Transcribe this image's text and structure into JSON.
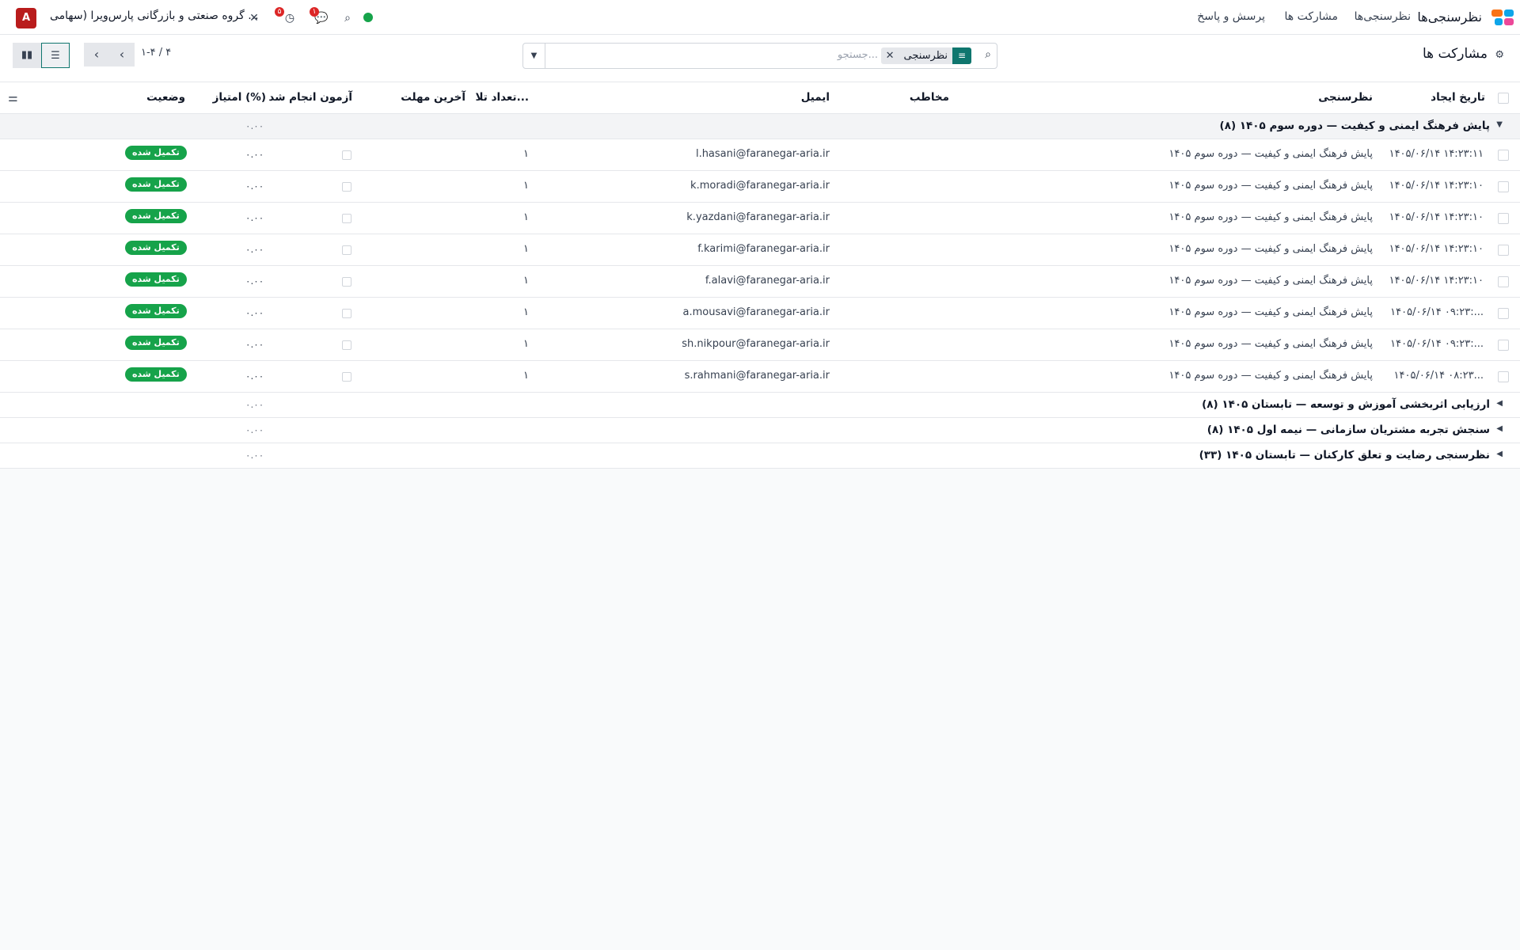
{
  "navbar": {
    "app_name": "نظرسنجی‌ها",
    "menu": [
      "نظرسنجی‌ها",
      "مشارکت ها",
      "پرسش و پاسخ"
    ],
    "company": "گروه صنعتی و بازرگانی پارس‌ویرا (سهامی ...",
    "avatar_letter": "A",
    "activity_badge": "۵",
    "messages_badge": "۱",
    "colors": {
      "brand_teal": "#0f766e",
      "status_green": "#16a34a",
      "avatar_red": "#b91c1c"
    }
  },
  "control": {
    "title": "مشارکت ها",
    "search_placeholder": "جستجو...",
    "facet_label": "نظرسنجی",
    "pager": "۱-۴ / ۴"
  },
  "columns": {
    "created": "تاریخ ایجاد",
    "survey": "نظرسنجی",
    "contact": "مخاطب",
    "email": "ایمیل",
    "attempts": "تعداد تلا...",
    "deadline": "آخرین مهلت",
    "done": "آزمون انجام شد",
    "score": "امتیاز (%)",
    "status": "وضعیت"
  },
  "open_group": {
    "label": "پایش فرهنگ ایمنی و کیفیت — دوره سوم ۱۴۰۵ (۸)",
    "score_sum": "۰.۰۰"
  },
  "rows": [
    {
      "created": "۱۴۰۵/۰۶/۱۴ ۱۴:۲۳:۱۱",
      "survey": "پایش فرهنگ ایمنی و کیفیت — دوره سوم ۱۴۰۵",
      "email": "l.hasani@faranegar-aria.ir",
      "attempts": "۱",
      "score": "۰.۰۰",
      "status": "تکمیل شده"
    },
    {
      "created": "۱۴۰۵/۰۶/۱۴ ۱۴:۲۳:۱۰",
      "survey": "پایش فرهنگ ایمنی و کیفیت — دوره سوم ۱۴۰۵",
      "email": "k.moradi@faranegar-aria.ir",
      "attempts": "۱",
      "score": "۰.۰۰",
      "status": "تکمیل شده"
    },
    {
      "created": "۱۴۰۵/۰۶/۱۴ ۱۴:۲۳:۱۰",
      "survey": "پایش فرهنگ ایمنی و کیفیت — دوره سوم ۱۴۰۵",
      "email": "k.yazdani@faranegar-aria.ir",
      "attempts": "۱",
      "score": "۰.۰۰",
      "status": "تکمیل شده"
    },
    {
      "created": "۱۴۰۵/۰۶/۱۴ ۱۴:۲۳:۱۰",
      "survey": "پایش فرهنگ ایمنی و کیفیت — دوره سوم ۱۴۰۵",
      "email": "f.karimi@faranegar-aria.ir",
      "attempts": "۱",
      "score": "۰.۰۰",
      "status": "تکمیل شده"
    },
    {
      "created": "۱۴۰۵/۰۶/۱۴ ۱۴:۲۳:۱۰",
      "survey": "پایش فرهنگ ایمنی و کیفیت — دوره سوم ۱۴۰۵",
      "email": "f.alavi@faranegar-aria.ir",
      "attempts": "۱",
      "score": "۰.۰۰",
      "status": "تکمیل شده"
    },
    {
      "created": "۱۴۰۵/۰۶/۱۴ ۰۹:۲۳:...",
      "survey": "پایش فرهنگ ایمنی و کیفیت — دوره سوم ۱۴۰۵",
      "email": "a.mousavi@faranegar-aria.ir",
      "attempts": "۱",
      "score": "۰.۰۰",
      "status": "تکمیل شده"
    },
    {
      "created": "۱۴۰۵/۰۶/۱۴ ۰۹:۲۳:...",
      "survey": "پایش فرهنگ ایمنی و کیفیت — دوره سوم ۱۴۰۵",
      "email": "sh.nikpour@faranegar-aria.ir",
      "attempts": "۱",
      "score": "۰.۰۰",
      "status": "تکمیل شده"
    },
    {
      "created": "۱۴۰۵/۰۶/۱۴ ۰۸:۲۳...",
      "survey": "پایش فرهنگ ایمنی و کیفیت — دوره سوم ۱۴۰۵",
      "email": "s.rahmani@faranegar-aria.ir",
      "attempts": "۱",
      "score": "۰.۰۰",
      "status": "تکمیل شده"
    }
  ],
  "closed_groups": [
    {
      "label": "ارزیابی اثربخشی آموزش و توسعه — تابستان ۱۴۰۵ (۸)",
      "score_sum": "۰.۰۰"
    },
    {
      "label": "سنجش تجربه مشتریان سازمانی — نیمه اول ۱۴۰۵ (۸)",
      "score_sum": "۰.۰۰"
    },
    {
      "label": "نظرسنجی رضایت و تعلق کارکنان — تابستان ۱۴۰۵ (۳۳)",
      "score_sum": "۰.۰۰"
    }
  ]
}
